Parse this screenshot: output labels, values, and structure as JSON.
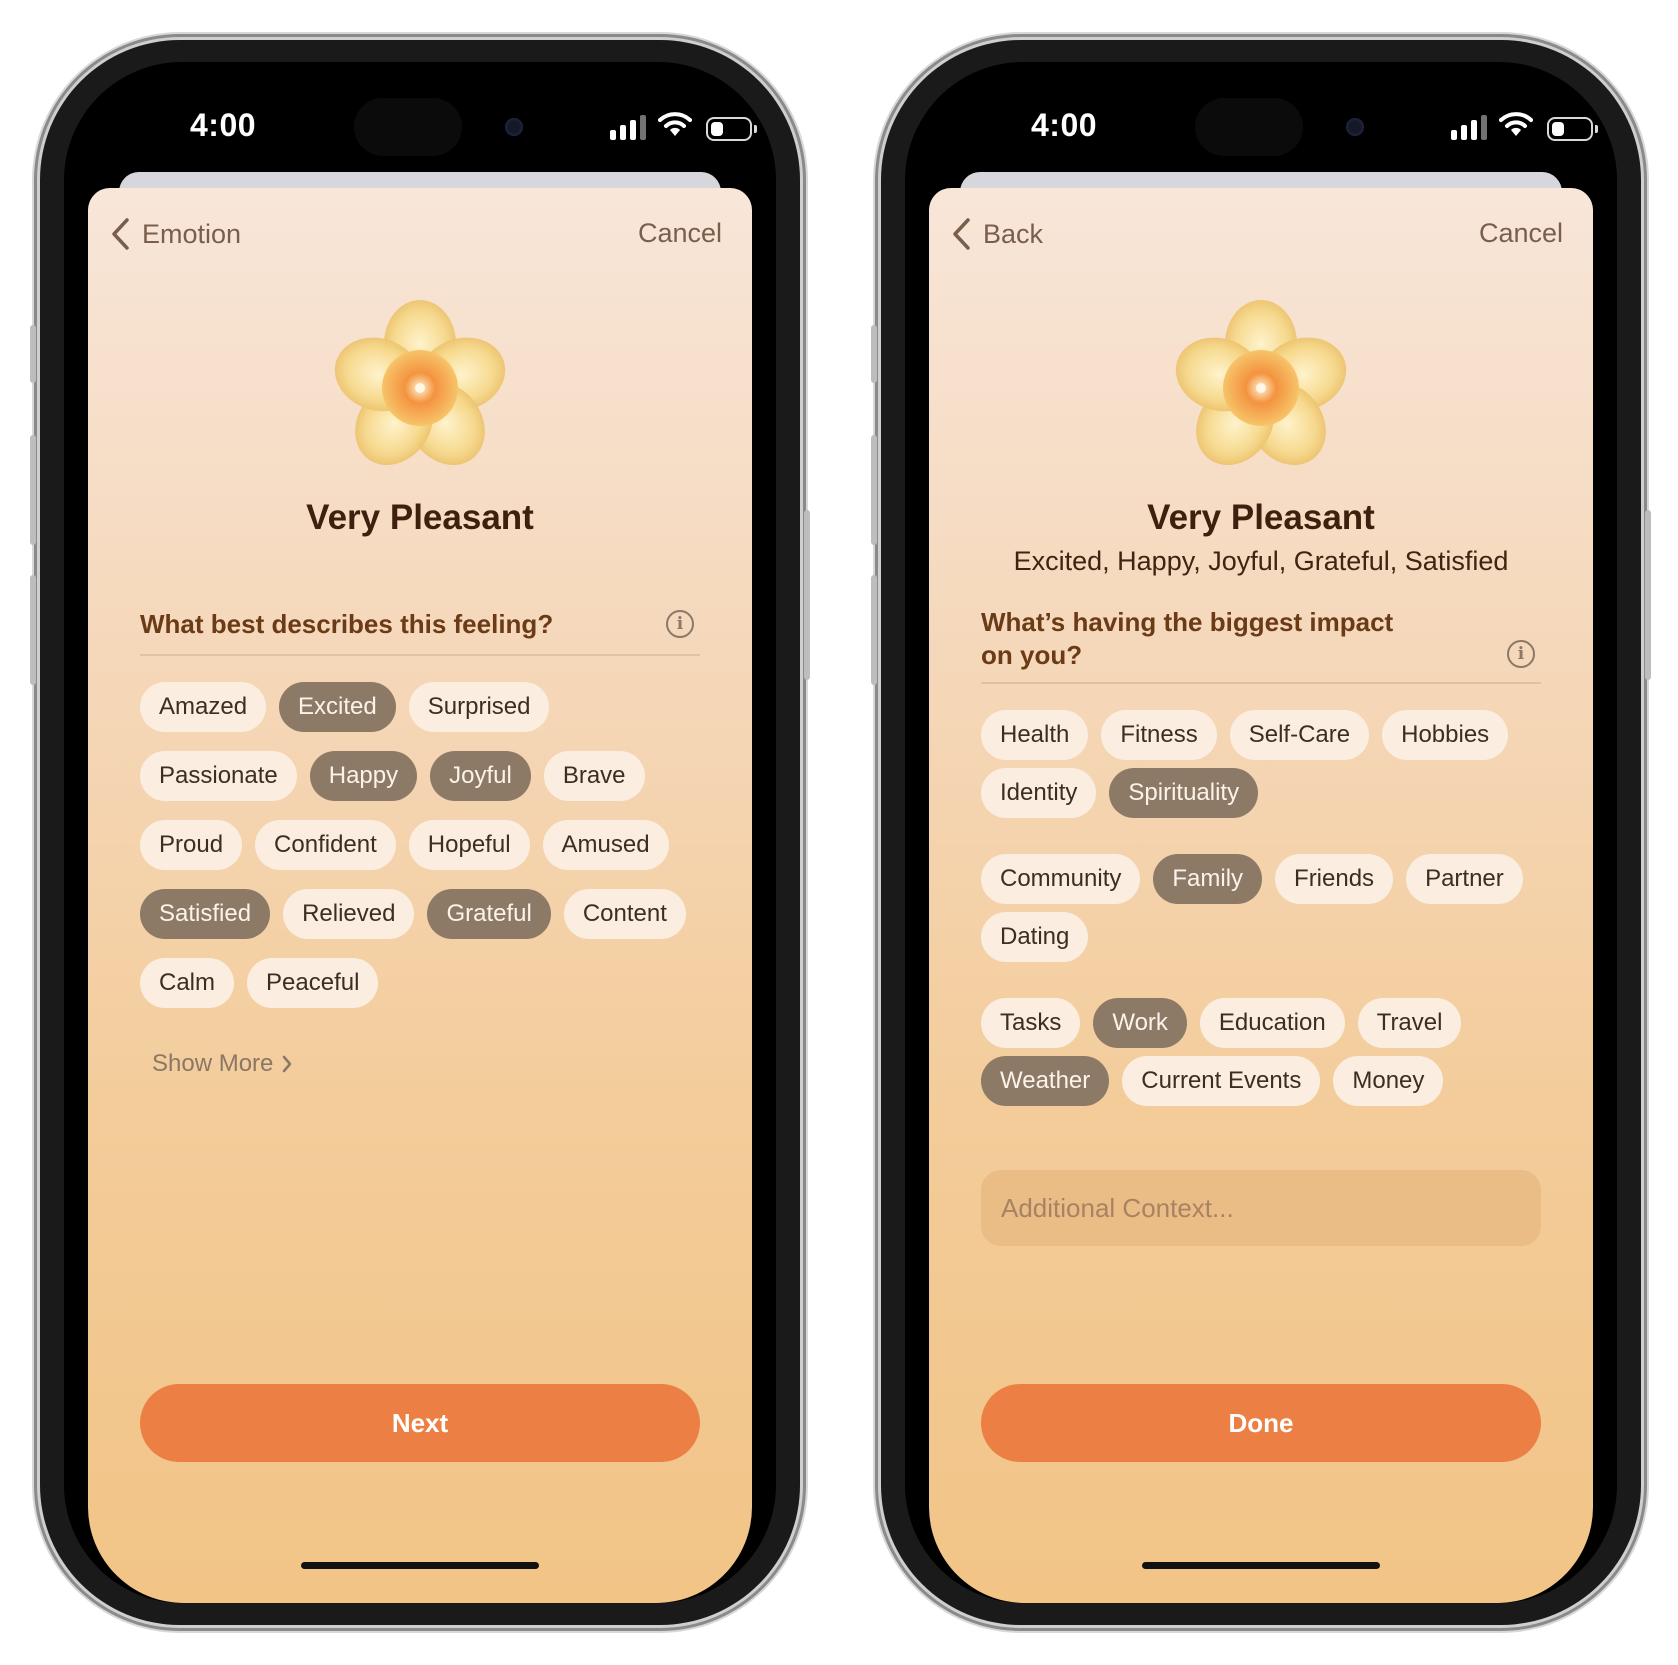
{
  "colors": {
    "accent_button": "#ec8044",
    "chip_selected": "#8d7a66",
    "chip_unselected": "#fbeee0",
    "title_text": "#3f1f0d",
    "question_text": "#6b3a17"
  },
  "left_screen": {
    "status": {
      "time": "4:00"
    },
    "nav": {
      "back_label": "Emotion",
      "cancel_label": "Cancel",
      "back_icon": "chevron-left-icon"
    },
    "flower_icon": "pleasant-flower-icon",
    "title": "Very Pleasant",
    "question": "What best describes this feeling?",
    "info_icon": "info-icon",
    "chip_rows": [
      [
        {
          "label": "Amazed",
          "selected": false
        },
        {
          "label": "Excited",
          "selected": true
        },
        {
          "label": "Surprised",
          "selected": false
        }
      ],
      [
        {
          "label": "Passionate",
          "selected": false
        },
        {
          "label": "Happy",
          "selected": true
        },
        {
          "label": "Joyful",
          "selected": true
        },
        {
          "label": "Brave",
          "selected": false
        }
      ],
      [
        {
          "label": "Proud",
          "selected": false
        },
        {
          "label": "Confident",
          "selected": false
        },
        {
          "label": "Hopeful",
          "selected": false
        },
        {
          "label": "Amused",
          "selected": false
        }
      ],
      [
        {
          "label": "Satisfied",
          "selected": true
        },
        {
          "label": "Relieved",
          "selected": false
        },
        {
          "label": "Grateful",
          "selected": true
        },
        {
          "label": "Content",
          "selected": false
        }
      ],
      [
        {
          "label": "Calm",
          "selected": false
        },
        {
          "label": "Peaceful",
          "selected": false
        }
      ]
    ],
    "show_more_label": "Show More",
    "primary_button_label": "Next"
  },
  "right_screen": {
    "status": {
      "time": "4:00"
    },
    "nav": {
      "back_label": "Back",
      "cancel_label": "Cancel",
      "back_icon": "chevron-left-icon"
    },
    "flower_icon": "pleasant-flower-icon",
    "title": "Very Pleasant",
    "subtitle": "Excited, Happy, Joyful, Grateful, Satisfied",
    "question_line1": "What’s having the biggest impact",
    "question_line2": "on you?",
    "info_icon": "info-icon",
    "chip_groups": [
      [
        [
          {
            "label": "Health",
            "selected": false
          },
          {
            "label": "Fitness",
            "selected": false
          },
          {
            "label": "Self-Care",
            "selected": false
          },
          {
            "label": "Hobbies",
            "selected": false
          }
        ],
        [
          {
            "label": "Identity",
            "selected": false
          },
          {
            "label": "Spirituality",
            "selected": true
          }
        ]
      ],
      [
        [
          {
            "label": "Community",
            "selected": false
          },
          {
            "label": "Family",
            "selected": true
          },
          {
            "label": "Friends",
            "selected": false
          },
          {
            "label": "Partner",
            "selected": false
          }
        ],
        [
          {
            "label": "Dating",
            "selected": false
          }
        ]
      ],
      [
        [
          {
            "label": "Tasks",
            "selected": false
          },
          {
            "label": "Work",
            "selected": true
          },
          {
            "label": "Education",
            "selected": false
          },
          {
            "label": "Travel",
            "selected": false
          }
        ],
        [
          {
            "label": "Weather",
            "selected": true
          },
          {
            "label": "Current Events",
            "selected": false
          },
          {
            "label": "Money",
            "selected": false
          }
        ]
      ]
    ],
    "context_placeholder": "Additional Context...",
    "primary_button_label": "Done"
  }
}
